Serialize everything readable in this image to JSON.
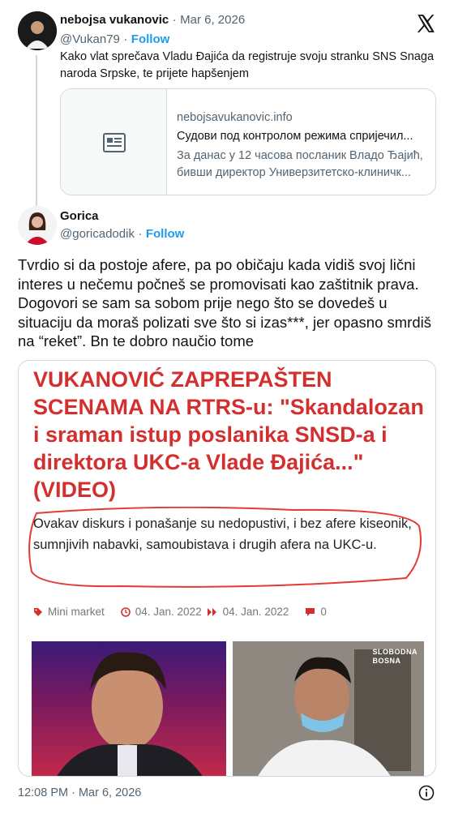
{
  "tweet1": {
    "author_name": "nebojsa vukanovic",
    "separator": "·",
    "date": "Mar 6, 2026",
    "handle": "@Vukan79",
    "follow_label": "Follow",
    "text": "Kako vlat sprečava Vladu Đajića da registruje svoju stranku SNS Snaga naroda Srpske, te prijete hapšenjem",
    "card": {
      "domain": "nebojsavukanovic.info",
      "title": "Судови под контролом режима спријечил...",
      "description": "За данас у 12 часова посланик Владо Ђајић, бивши директор Универзитетско-клиничк..."
    }
  },
  "tweet2": {
    "author_name": "Gorica",
    "handle": "@goricadodik",
    "separator": "·",
    "follow_label": "Follow",
    "text": "Tvrdio si da postoje afere, pa po običaju kada vidiš svoj lični interes u nečemu počneš se promovisati kao zaštitnik prava. Dogovori se sam sa sobom prije nego što se dovedeš u situaciju da moraš polizati sve što si izas***, jer opasno smrdiš na “reket”. Bn te dobro naučio tome",
    "media": {
      "headline": "VUKANOVIĆ ZAPREPAŠTEN SCENAMA NA RTRS-u: \"Skandalozan i sraman istup poslanika SNSD-a i direktora UKC-a Vlade Đajića...\" (VIDEO)",
      "quote": "Ovakav diskurs i ponašanje su nedopustivi, i bez afere kiseonik, sumnjivih nabavki, samoubistava i drugih afera na UKC-u.",
      "category": "Mini market",
      "date_from": "04. Jan. 2022",
      "date_to": "04. Jan. 2022",
      "comments": "0",
      "watermark_line1": "SLOBODNA",
      "watermark_line2": "BOSNA"
    },
    "timestamp": "12:08 PM · Mar 6, 2026"
  },
  "colors": {
    "accent": "#1d9bf0",
    "text": "#0f1419",
    "muted": "#536471",
    "border": "#cfd9de",
    "headline_red": "#d32f2f"
  },
  "icons": {
    "x_logo": "x-logo-icon",
    "card_placeholder": "article-icon",
    "info": "info-icon",
    "tag": "tag-icon",
    "clock": "clock-icon",
    "forward": "double-arrow-icon",
    "comment": "comment-icon"
  }
}
